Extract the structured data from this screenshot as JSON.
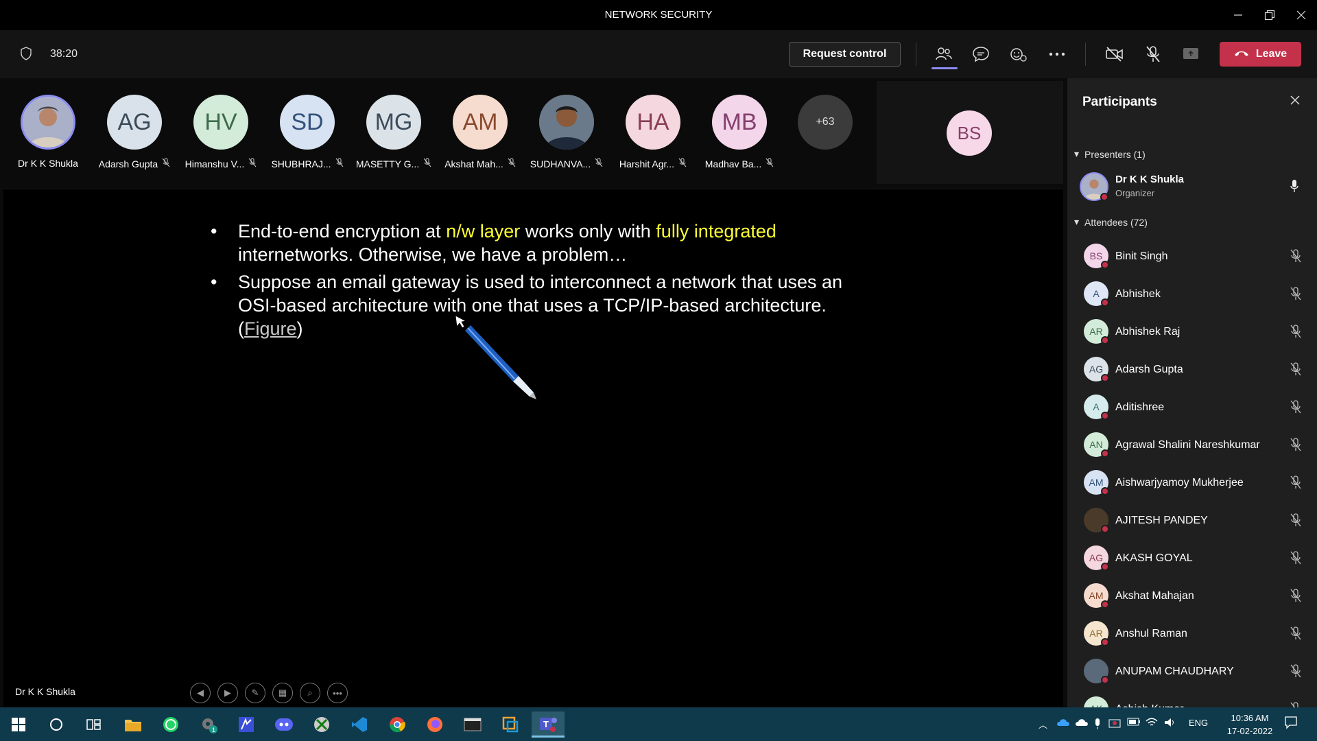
{
  "window": {
    "title": "NETWORK SECURITY"
  },
  "toolbar": {
    "timer": "38:20",
    "request_control": "Request control",
    "leave": "Leave"
  },
  "gallery": {
    "tiles": [
      {
        "name": "Dr K K Shukla",
        "initials": "",
        "bg": "#c9c9e8",
        "fg": "#333"
      },
      {
        "name": "Adarsh Gupta",
        "initials": "AG",
        "bg": "#d9e2ea",
        "fg": "#3a4a58"
      },
      {
        "name": "Himanshu V...",
        "initials": "HV",
        "bg": "#d3ecd9",
        "fg": "#3d6b4b"
      },
      {
        "name": "SHUBHRAJ...",
        "initials": "SD",
        "bg": "#d7e3f2",
        "fg": "#34527a"
      },
      {
        "name": "MASETTY G...",
        "initials": "MG",
        "bg": "#dbe3e9",
        "fg": "#3d4c5a"
      },
      {
        "name": "Akshat Mah...",
        "initials": "AM",
        "bg": "#f6dccf",
        "fg": "#8a4a2d"
      },
      {
        "name": "SUDHANVA...",
        "initials": "",
        "bg": "#7b6a55",
        "fg": "#fff"
      },
      {
        "name": "Harshit Agr...",
        "initials": "HA",
        "bg": "#f4d7df",
        "fg": "#8a3e53"
      },
      {
        "name": "Madhav Ba...",
        "initials": "MB",
        "bg": "#f3d6ea",
        "fg": "#85406f"
      }
    ],
    "more": "+63",
    "spotlight_initials": "BS"
  },
  "slide": {
    "b1_pre": "End-to-end encryption at ",
    "b1_hl1": "n/w layer",
    "b1_mid": " works only with ",
    "b1_hl2": "fully integrated",
    "b1_post": " internetworks. Otherwise, we have a problem…",
    "b2_pre": "Suppose an email gateway is used to interconnect a network that uses an OSI-based architecture with one that uses a TCP/IP-based architecture. (",
    "b2_link": "Figure",
    "b2_post": ")"
  },
  "stage": {
    "presenter_name": "Dr K K Shukla"
  },
  "panel": {
    "title": "Participants",
    "presenters_header": "Presenters (1)",
    "presenter": {
      "name": "Dr K K Shukla",
      "role": "Organizer"
    },
    "attendees_header": "Attendees (72)",
    "attendees": [
      {
        "name": "Binit Singh",
        "initials": "BS",
        "bg": "#f3d6ea",
        "fg": "#85406f"
      },
      {
        "name": "Abhishek",
        "initials": "A",
        "bg": "#dfe6f5",
        "fg": "#34527a"
      },
      {
        "name": "Abhishek Raj",
        "initials": "AR",
        "bg": "#d3ecd9",
        "fg": "#3d6b4b"
      },
      {
        "name": "Adarsh Gupta",
        "initials": "AG",
        "bg": "#dbe3e9",
        "fg": "#3d4c5a"
      },
      {
        "name": "Aditishree",
        "initials": "A",
        "bg": "#d6ecec",
        "fg": "#3b6b6b"
      },
      {
        "name": "Agrawal Shalini Nareshkumar",
        "initials": "AN",
        "bg": "#d3ecd9",
        "fg": "#3d6b4b"
      },
      {
        "name": "Aishwarjyamoy Mukherjee",
        "initials": "AM",
        "bg": "#d7e3f2",
        "fg": "#34527a"
      },
      {
        "name": "AJITESH PANDEY",
        "initials": "",
        "bg": "#4a3a2a",
        "fg": "#fff"
      },
      {
        "name": "AKASH GOYAL",
        "initials": "AG",
        "bg": "#f4d7df",
        "fg": "#8a3e53"
      },
      {
        "name": "Akshat Mahajan",
        "initials": "AM",
        "bg": "#f6dccf",
        "fg": "#8a4a2d"
      },
      {
        "name": "Anshul Raman",
        "initials": "AR",
        "bg": "#f6e6cf",
        "fg": "#8a6a2d"
      },
      {
        "name": "ANUPAM CHAUDHARY",
        "initials": "",
        "bg": "#5a6a7a",
        "fg": "#fff"
      },
      {
        "name": "Ashish Kumar",
        "initials": "AK",
        "bg": "#d3ecd9",
        "fg": "#3d6b4b"
      }
    ]
  },
  "taskbar": {
    "lang": "ENG",
    "time": "10:36 AM",
    "date": "17-02-2022",
    "badge": "1"
  }
}
